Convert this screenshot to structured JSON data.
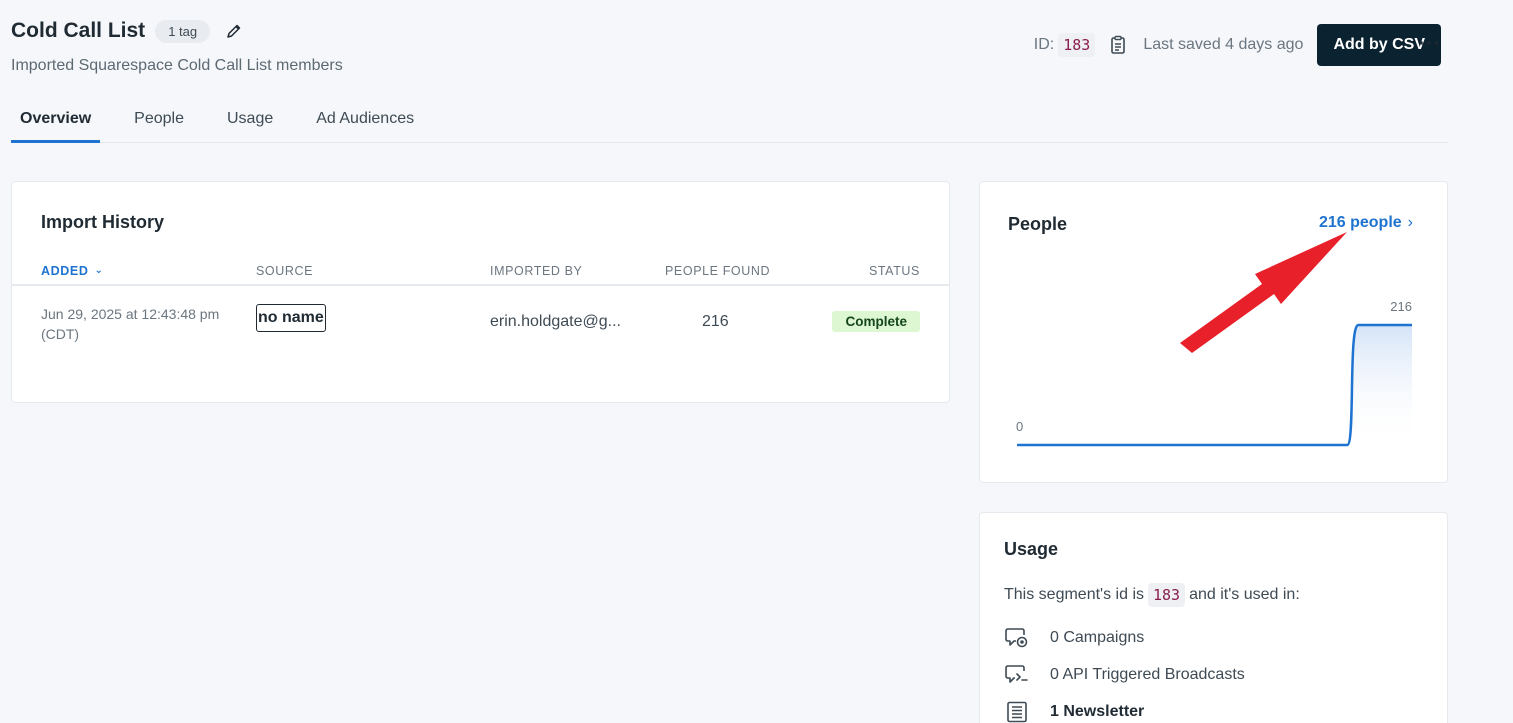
{
  "header": {
    "title": "Cold Call List",
    "tag_badge": "1 tag",
    "subtitle": "Imported Squarespace Cold Call List members",
    "id_label": "ID:",
    "id_value": "183",
    "last_saved": "Last saved 4 days ago",
    "primary_button": "Add by CSV",
    "more_label": "···"
  },
  "tabs": [
    {
      "label": "Overview",
      "active": true
    },
    {
      "label": "People",
      "active": false
    },
    {
      "label": "Usage",
      "active": false
    },
    {
      "label": "Ad Audiences",
      "active": false
    }
  ],
  "import_history": {
    "title": "Import History",
    "columns": {
      "added": "ADDED",
      "source": "SOURCE",
      "imported_by": "IMPORTED BY",
      "people_found": "PEOPLE FOUND",
      "status": "STATUS"
    },
    "rows": [
      {
        "date_line1": "Jun 29, 2025 at 12:43:48 pm",
        "date_line2": "(CDT)",
        "source": "no name",
        "imported_by": "erin.holdgate@g...",
        "people_found": "216",
        "status": "Complete"
      }
    ]
  },
  "people": {
    "title": "People",
    "link_label": "216 people",
    "chart_data": {
      "type": "area",
      "values": [
        0,
        0,
        0,
        0,
        0,
        0,
        0,
        0,
        0,
        0,
        0,
        216,
        216
      ],
      "labels": [
        "0",
        "216"
      ],
      "ylim": [
        0,
        216
      ],
      "color": "#1f73d0"
    }
  },
  "usage": {
    "title": "Usage",
    "desc_prefix": "This segment's id is",
    "desc_id": "183",
    "desc_suffix": "and it's used in:",
    "items": [
      {
        "icon": "campaign-icon",
        "label": "0 Campaigns",
        "bold": false
      },
      {
        "icon": "api-broadcast-icon",
        "label": "0 API Triggered Broadcasts",
        "bold": false
      },
      {
        "icon": "newsletter-icon",
        "label": "1 Newsletter",
        "bold": true
      }
    ]
  },
  "colors": {
    "accent": "#1f73d0",
    "primary_button": "#0b2230",
    "status_bg": "#dcf7d2",
    "annotation_arrow": "#e8202a"
  }
}
